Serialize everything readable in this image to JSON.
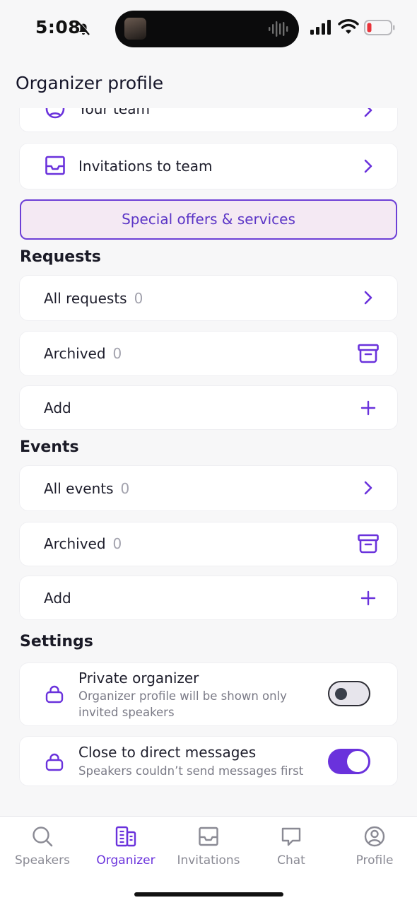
{
  "status": {
    "time": "5:08"
  },
  "header": {
    "title": "Organizer profile"
  },
  "team": {
    "your_team_label": "Your team",
    "invitations_label": "Invitations to team"
  },
  "offers": {
    "label": "Special offers & services"
  },
  "requests": {
    "title": "Requests",
    "all_label": "All requests",
    "all_count": "0",
    "archived_label": "Archived",
    "archived_count": "0",
    "add_label": "Add"
  },
  "events": {
    "title": "Events",
    "all_label": "All events",
    "all_count": "0",
    "archived_label": "Archived",
    "archived_count": "0",
    "add_label": "Add"
  },
  "settings": {
    "title": "Settings",
    "private": {
      "title": "Private organizer",
      "desc": "Organizer profile will be shown only invited speakers",
      "enabled": false
    },
    "close_dm": {
      "title": "Close to direct messages",
      "desc": "Speakers couldn’t send messages first",
      "enabled": true
    }
  },
  "tabs": [
    {
      "label": "Speakers",
      "icon": "search-icon",
      "active": false
    },
    {
      "label": "Organizer",
      "icon": "organizer-icon",
      "active": true
    },
    {
      "label": "Invitations",
      "icon": "inbox-icon",
      "active": false
    },
    {
      "label": "Chat",
      "icon": "chat-icon",
      "active": false
    },
    {
      "label": "Profile",
      "icon": "profile-icon",
      "active": false
    }
  ],
  "colors": {
    "accent": "#6a32dc",
    "offers_bg": "#f4e9f3",
    "background": "#f7f7f8"
  }
}
